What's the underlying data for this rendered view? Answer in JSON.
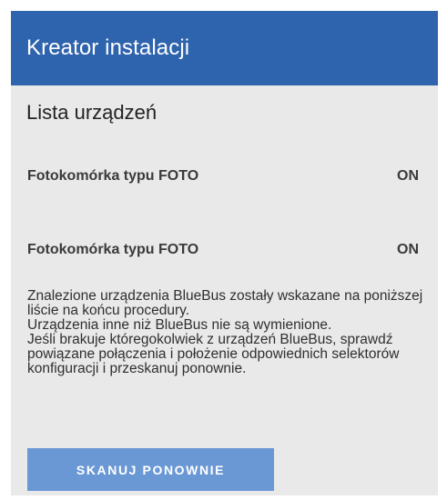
{
  "header": {
    "title": "Kreator instalacji"
  },
  "section": {
    "title": "Lista urządzeń"
  },
  "devices": [
    {
      "name": "Fotokomórka typu FOTO",
      "status": "ON"
    },
    {
      "name": "Fotokomórka typu FOTO",
      "status": "ON"
    }
  ],
  "info": {
    "lines": [
      "Znalezione urządzenia BlueBus zostały wskazane na poniższej liście na końcu procedury.",
      "Urządzenia inne niż BlueBus nie są wymienione.",
      "Jeśli brakuje któregokolwiek z urządzeń BlueBus, sprawdź powiązane połączenia i położenie odpowiednich selektorów konfiguracji i przeskanuj ponownie."
    ]
  },
  "actions": {
    "rescan_label": "SKANUJ PONOWNIE"
  },
  "colors": {
    "header_bg": "#2e63ad",
    "panel_bg": "#e9e9e9",
    "button_bg": "#6a98d4"
  }
}
